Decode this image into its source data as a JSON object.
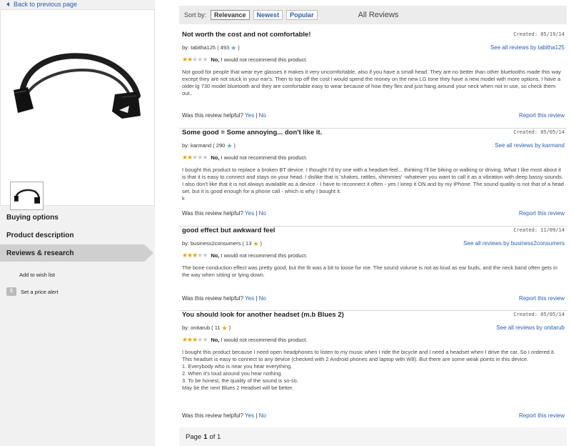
{
  "nav": {
    "back_label": "Back to previous page",
    "buying": "Buying options",
    "description": "Product description",
    "reviews": "Reviews & research",
    "wish": "Add to wish list",
    "price_alert": "Set a price alert"
  },
  "sort": {
    "label": "Sort by:",
    "options": [
      "Relevance",
      "Newest",
      "Popular"
    ],
    "active": "Relevance",
    "heading": "All Reviews"
  },
  "reviews": [
    {
      "title": "Not worth the cost and not comfortable!",
      "created": "Created: 05/19/14",
      "by_label": "by:",
      "user": "tabitha125",
      "count_open": "( 493",
      "count_close": ")",
      "star_color": "#5aa8e0",
      "see_all": "See all reviews by tabitha125",
      "rating": 2,
      "rec_no": "No,",
      "rec_text": " I would not recommend this product.",
      "body": "Not good for people that wear eye glasses it makes it very uncomfortable, also if you have a small head. They are no better than other bluetooths made this way except they are not stuck in your ear's. Then to top off the cost i would spend the money on the new LG tone they have a new model with more options. I have a older lg 730 model bluetooth and they are comfortable easy to wear because of how they flex and just hang around your neck when not in use, so check them out..",
      "helpful_q": "Was this review helpful?",
      "yes": "Yes",
      "sep": "|",
      "no": "No",
      "report": "Report this review"
    },
    {
      "title": "Some good = Some annoying... don't like it.",
      "created": "Created: 05/05/14",
      "by_label": "by:",
      "user": "karmand",
      "count_open": "( 290",
      "count_close": ")",
      "star_color": "#5aa8e0",
      "see_all": "See all reviews by karmand",
      "rating": 2,
      "rec_no": "No,",
      "rec_text": " I would not recommend this product.",
      "body": "I bought this product to replace a broken BT device. I thought I'd try one with a headset-feel... thinking I'll be biking or walking or driving. What I like most about it is that it is easy to connect and stays on your head. I dislike that is 'shakes, rattles, shimmies' -whatever you want to call it as a vibration with deep bassy sounds. I also don't like that it is not always available as a device - I have to reconnect it often - yes I keep it ON and by my iPhone. The sound quality is not that of a head set, but it is good enough for a phone call - which is why I bought it.\nk",
      "helpful_q": "Was this review helpful?",
      "yes": "Yes",
      "sep": "|",
      "no": "No",
      "report": "Report this review"
    },
    {
      "title": "good effect but awkward feel",
      "created": "Created: 11/09/14",
      "by_label": "by:",
      "user": "business2consumers",
      "count_open": "( 13",
      "count_close": ")",
      "star_color": "#e6a700",
      "see_all": "See all reviews by business2consumers",
      "rating": 3,
      "rec_no": "No,",
      "rec_text": " I would not recommend this product.",
      "body": "The bone conduction effect was pretty good, but the fit was a bit to loose for me. The sound volume is not as loud as ear buds, and the neck band often gets in the way when sitting or lying down.",
      "helpful_q": "Was this review helpful?",
      "yes": "Yes",
      "sep": "|",
      "no": "No",
      "report": "Report this review"
    },
    {
      "title": "You should look for another headset (m.b Blues 2)",
      "created": "Created: 05/05/14",
      "by_label": "by:",
      "user": "onitarub",
      "count_open": "( 11",
      "count_close": ")",
      "star_color": "#e6a700",
      "see_all": "See all reviews by onitarub",
      "rating": 3,
      "rec_no": "No,",
      "rec_text": " I would not recommend this product.",
      "body": "I bought this product because I need open headphones to listen to my music when I ride the bicycle and I need a headset when I drive the car. So I ordered it. This headset is easy to connect to any device (checked with 2 Android phones and laptop with W8). But there are some weak points in this device.\n1. Everybody who is near you hear everything.\n2. When it's loud around you hear nothing.\n3. To be honest, the quality of the sound is so-so.\nMay be the next Blues 2 Headset will be better.",
      "helpful_q": "Was this review helpful?",
      "yes": "Yes",
      "sep": "|",
      "no": "No",
      "report": "Report this review"
    }
  ],
  "pager": {
    "prefix": "Page",
    "current": "1",
    "suffix": "of 1"
  },
  "colors": {
    "link": "#2a5db0",
    "star_on": "#e6a700",
    "star_off": "#c8c8c8",
    "nav_active_bg": "#cfcfcf"
  }
}
